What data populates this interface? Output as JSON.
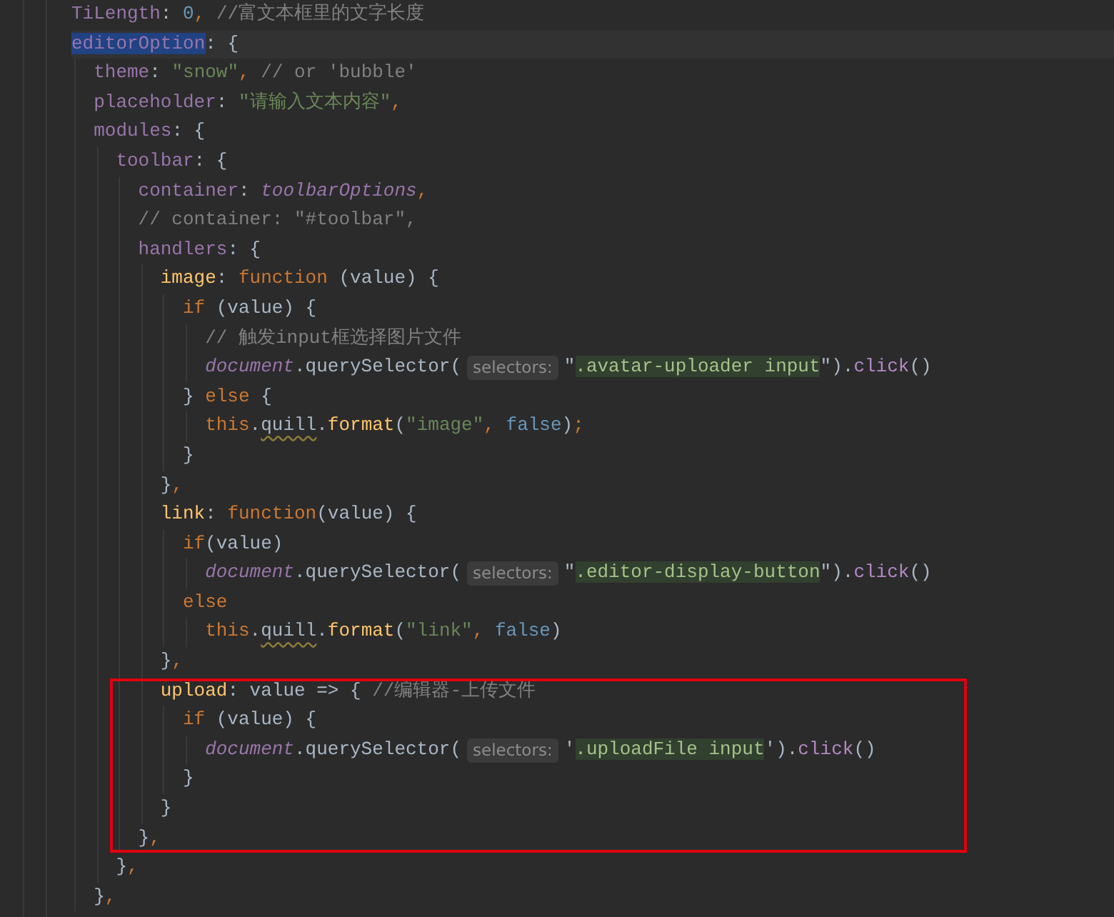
{
  "editor": {
    "lines": [
      {
        "tokens": [
          {
            "kind": "key",
            "text": "TiLength"
          },
          {
            "kind": "punct",
            "text": ": "
          },
          {
            "kind": "number",
            "text": "0"
          },
          {
            "kind": "keyword",
            "text": ", "
          },
          {
            "kind": "comment",
            "text": "//富文本框里的文字长度"
          }
        ]
      },
      {
        "current": true,
        "tokens": [
          {
            "kind": "selection",
            "text": "editorOption"
          },
          {
            "kind": "punct",
            "text": ": {"
          }
        ],
        "children": [
          {
            "tokens": [
              {
                "kind": "key",
                "text": "theme"
              },
              {
                "kind": "punct",
                "text": ": "
              },
              {
                "kind": "string",
                "text": "\"snow\""
              },
              {
                "kind": "keyword",
                "text": ","
              },
              {
                "kind": "comment",
                "text": " // or 'bubble'"
              }
            ]
          },
          {
            "tokens": [
              {
                "kind": "key",
                "text": "placeholder"
              },
              {
                "kind": "punct",
                "text": ": "
              },
              {
                "kind": "string",
                "text": "\"请输入文本内容\""
              },
              {
                "kind": "keyword",
                "text": ","
              }
            ]
          },
          {
            "tokens": [
              {
                "kind": "key",
                "text": "modules"
              },
              {
                "kind": "punct",
                "text": ": {"
              }
            ],
            "children": [
              {
                "tokens": [
                  {
                    "kind": "key",
                    "text": "toolbar"
                  },
                  {
                    "kind": "punct",
                    "text": ": {"
                  }
                ],
                "children": [
                  {
                    "tokens": [
                      {
                        "kind": "key",
                        "text": "container"
                      },
                      {
                        "kind": "punct",
                        "text": ": "
                      },
                      {
                        "kind": "global",
                        "text": "toolbarOptions"
                      },
                      {
                        "kind": "keyword",
                        "text": ","
                      }
                    ]
                  },
                  {
                    "tokens": [
                      {
                        "kind": "comment",
                        "text": "// container: \"#toolbar\","
                      }
                    ]
                  },
                  {
                    "tokens": [
                      {
                        "kind": "key",
                        "text": "handlers"
                      },
                      {
                        "kind": "punct",
                        "text": ": {"
                      }
                    ],
                    "children": [
                      {
                        "tokens": [
                          {
                            "kind": "func",
                            "text": "image"
                          },
                          {
                            "kind": "punct",
                            "text": ": "
                          },
                          {
                            "kind": "keyword",
                            "text": "function "
                          },
                          {
                            "kind": "punct",
                            "text": "(value) {"
                          }
                        ],
                        "children": [
                          {
                            "tokens": [
                              {
                                "kind": "keyword",
                                "text": "if "
                              },
                              {
                                "kind": "punct",
                                "text": "(value) {"
                              }
                            ],
                            "children": [
                              {
                                "tokens": [
                                  {
                                    "kind": "comment",
                                    "text": "// 触发input框选择图片文件"
                                  }
                                ]
                              },
                              {
                                "tokens": [
                                  {
                                    "kind": "global",
                                    "text": "document"
                                  },
                                  {
                                    "kind": "punct",
                                    "text": ".querySelector("
                                  },
                                  {
                                    "kind": "hint",
                                    "text": "selectors:"
                                  },
                                  {
                                    "kind": "punct",
                                    "text": "\""
                                  },
                                  {
                                    "kind": "match",
                                    "text": ".avatar-uploader input"
                                  },
                                  {
                                    "kind": "punct",
                                    "text": "\")."
                                  },
                                  {
                                    "kind": "call",
                                    "text": "click"
                                  },
                                  {
                                    "kind": "punct",
                                    "text": "()"
                                  }
                                ]
                              }
                            ]
                          },
                          {
                            "tokens": [
                              {
                                "kind": "punct",
                                "text": "} "
                              },
                              {
                                "kind": "keyword",
                                "text": "else "
                              },
                              {
                                "kind": "punct",
                                "text": "{"
                              }
                            ],
                            "children": [
                              {
                                "tokens": [
                                  {
                                    "kind": "this",
                                    "text": "this"
                                  },
                                  {
                                    "kind": "punct",
                                    "text": "."
                                  },
                                  {
                                    "kind": "typo",
                                    "text": "quill"
                                  },
                                  {
                                    "kind": "punct",
                                    "text": "."
                                  },
                                  {
                                    "kind": "func",
                                    "text": "format"
                                  },
                                  {
                                    "kind": "punct",
                                    "text": "("
                                  },
                                  {
                                    "kind": "string",
                                    "text": "\"image\""
                                  },
                                  {
                                    "kind": "keyword",
                                    "text": ", "
                                  },
                                  {
                                    "kind": "constant",
                                    "text": "false"
                                  },
                                  {
                                    "kind": "punct",
                                    "text": ")"
                                  },
                                  {
                                    "kind": "keyword",
                                    "text": ";"
                                  }
                                ]
                              }
                            ],
                            "close": [
                              {
                                "kind": "punct",
                                "text": "}"
                              }
                            ]
                          }
                        ],
                        "close": [
                          {
                            "kind": "punct",
                            "text": "}"
                          },
                          {
                            "kind": "keyword",
                            "text": ","
                          }
                        ]
                      },
                      {
                        "tokens": [
                          {
                            "kind": "func",
                            "text": "link"
                          },
                          {
                            "kind": "punct",
                            "text": ": "
                          },
                          {
                            "kind": "keyword",
                            "text": "function"
                          },
                          {
                            "kind": "punct",
                            "text": "(value) {"
                          }
                        ],
                        "children": [
                          {
                            "tokens": [
                              {
                                "kind": "keyword",
                                "text": "if"
                              },
                              {
                                "kind": "punct",
                                "text": "(value)"
                              }
                            ],
                            "children": [
                              {
                                "tokens": [
                                  {
                                    "kind": "global",
                                    "text": "document"
                                  },
                                  {
                                    "kind": "punct",
                                    "text": ".querySelector("
                                  },
                                  {
                                    "kind": "hint",
                                    "text": "selectors:"
                                  },
                                  {
                                    "kind": "punct",
                                    "text": "\""
                                  },
                                  {
                                    "kind": "match",
                                    "text": ".editor-display-button"
                                  },
                                  {
                                    "kind": "punct",
                                    "text": "\")."
                                  },
                                  {
                                    "kind": "call",
                                    "text": "click"
                                  },
                                  {
                                    "kind": "punct",
                                    "text": "()"
                                  }
                                ]
                              }
                            ]
                          },
                          {
                            "tokens": [
                              {
                                "kind": "keyword",
                                "text": "else"
                              }
                            ],
                            "children": [
                              {
                                "tokens": [
                                  {
                                    "kind": "this",
                                    "text": "this"
                                  },
                                  {
                                    "kind": "punct",
                                    "text": "."
                                  },
                                  {
                                    "kind": "typo",
                                    "text": "quill"
                                  },
                                  {
                                    "kind": "punct",
                                    "text": "."
                                  },
                                  {
                                    "kind": "func",
                                    "text": "format"
                                  },
                                  {
                                    "kind": "punct",
                                    "text": "("
                                  },
                                  {
                                    "kind": "string",
                                    "text": "\"link\""
                                  },
                                  {
                                    "kind": "keyword",
                                    "text": ", "
                                  },
                                  {
                                    "kind": "constant",
                                    "text": "false"
                                  },
                                  {
                                    "kind": "punct",
                                    "text": ")"
                                  }
                                ]
                              }
                            ]
                          }
                        ],
                        "close": [
                          {
                            "kind": "punct",
                            "text": "}"
                          },
                          {
                            "kind": "keyword",
                            "text": ","
                          }
                        ]
                      },
                      {
                        "boxed": true,
                        "tokens": [
                          {
                            "kind": "func",
                            "text": "upload"
                          },
                          {
                            "kind": "punct",
                            "text": ": value => { "
                          },
                          {
                            "kind": "comment",
                            "text": "//编辑器-上传文件"
                          }
                        ],
                        "children": [
                          {
                            "tokens": [
                              {
                                "kind": "keyword",
                                "text": "if "
                              },
                              {
                                "kind": "punct",
                                "text": "(value) {"
                              }
                            ],
                            "children": [
                              {
                                "tokens": [
                                  {
                                    "kind": "global",
                                    "text": "document"
                                  },
                                  {
                                    "kind": "punct",
                                    "text": ".querySelector("
                                  },
                                  {
                                    "kind": "hint",
                                    "text": "selectors:"
                                  },
                                  {
                                    "kind": "punct",
                                    "text": "'"
                                  },
                                  {
                                    "kind": "match",
                                    "text": ".uploadFile input"
                                  },
                                  {
                                    "kind": "punct",
                                    "text": "')."
                                  },
                                  {
                                    "kind": "call",
                                    "text": "click"
                                  },
                                  {
                                    "kind": "punct",
                                    "text": "()"
                                  }
                                ]
                              }
                            ],
                            "close": [
                              {
                                "kind": "punct",
                                "text": "}"
                              }
                            ]
                          }
                        ],
                        "close": [
                          {
                            "kind": "punct",
                            "text": "}"
                          }
                        ]
                      }
                    ],
                    "close_boxed": true,
                    "close": [
                      {
                        "kind": "punct",
                        "text": "}"
                      },
                      {
                        "kind": "keyword",
                        "text": ","
                      }
                    ]
                  }
                ],
                "close": [
                  {
                    "kind": "punct",
                    "text": "}"
                  },
                  {
                    "kind": "keyword",
                    "text": ","
                  }
                ]
              }
            ],
            "close": [
              {
                "kind": "punct",
                "text": "}"
              },
              {
                "kind": "keyword",
                "text": ","
              }
            ]
          }
        ]
      }
    ]
  }
}
